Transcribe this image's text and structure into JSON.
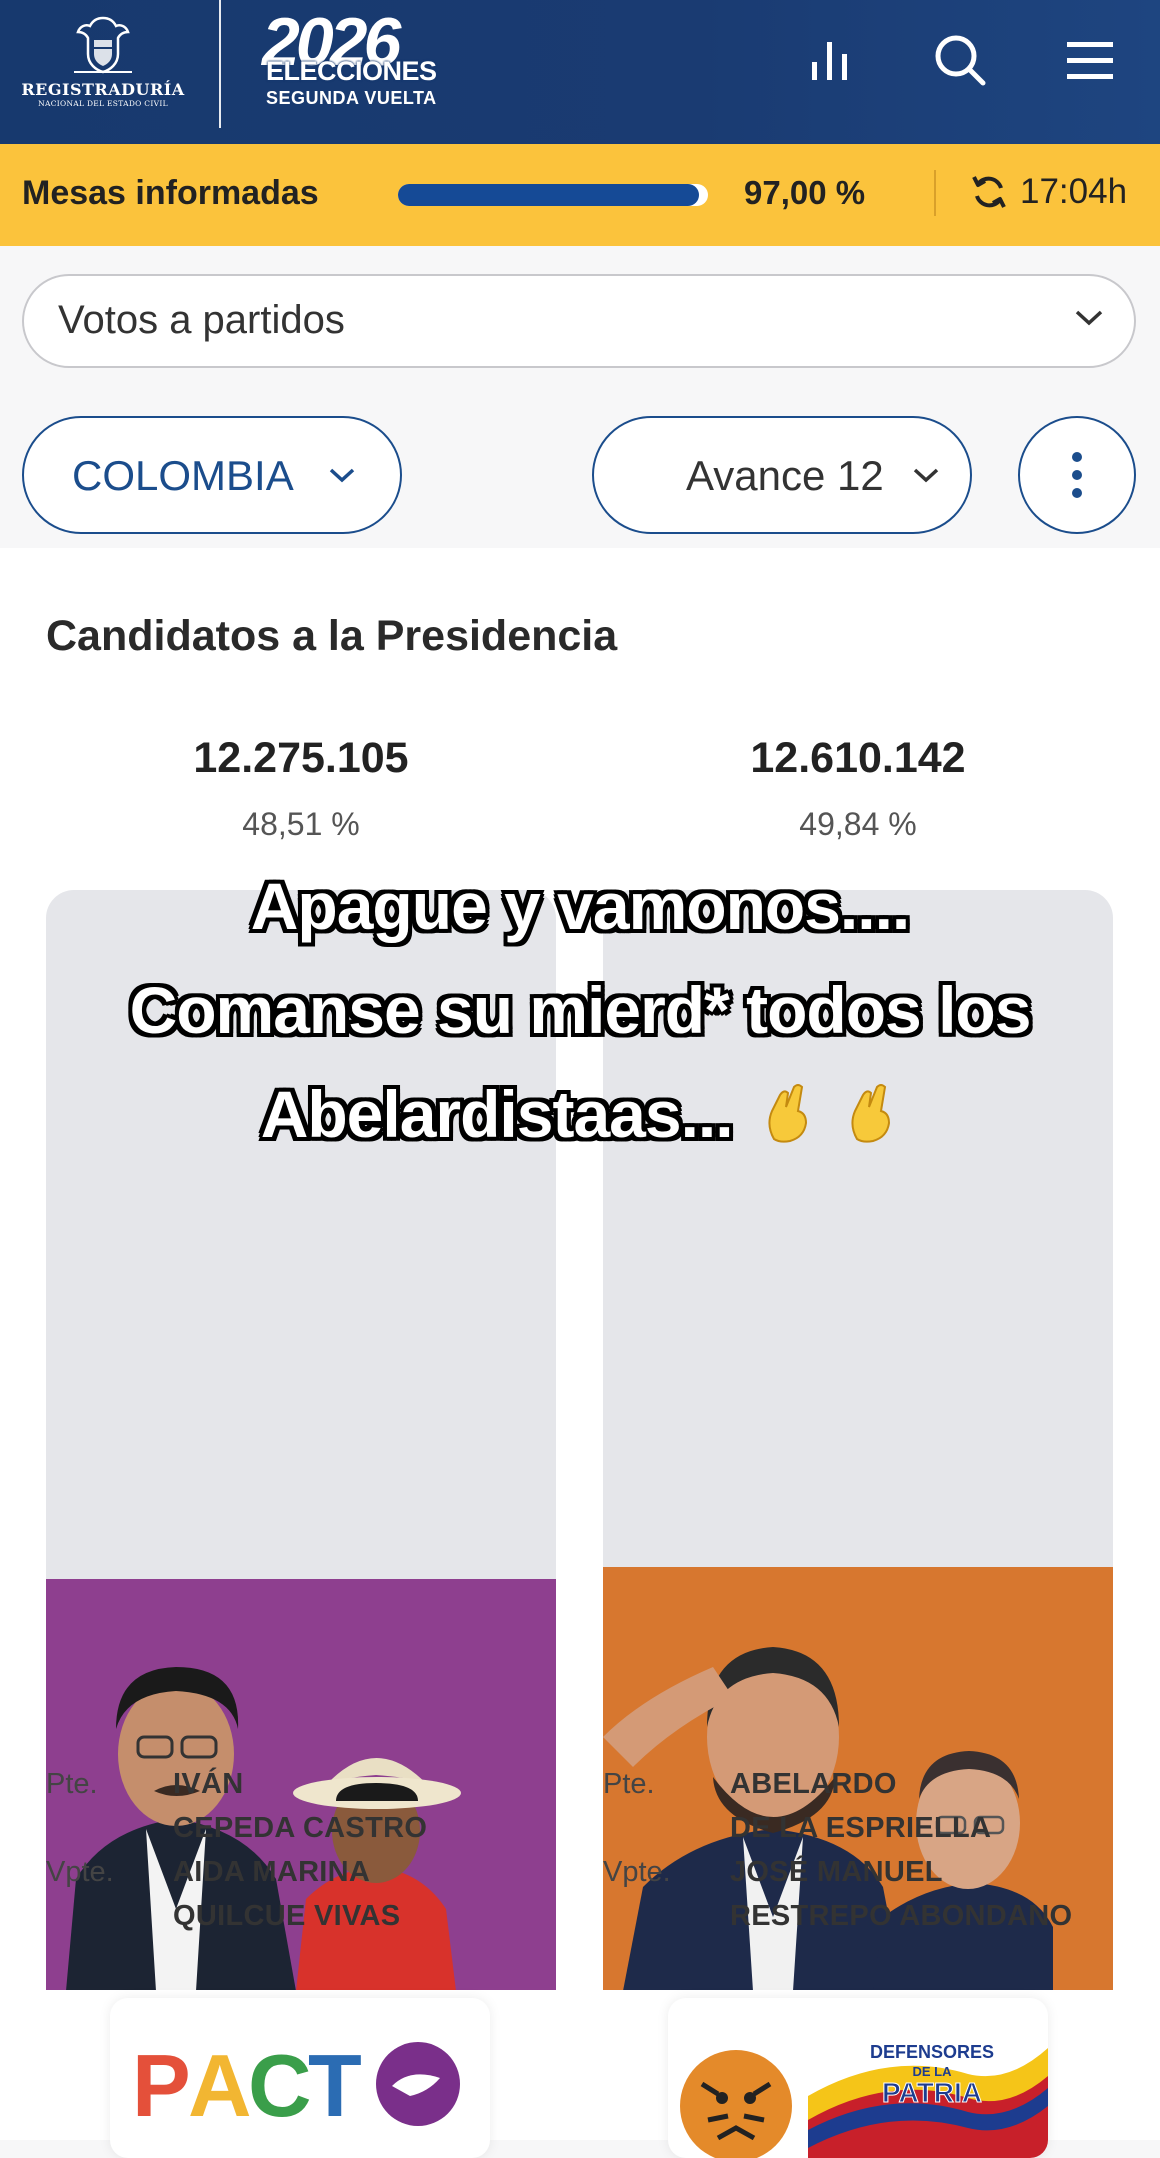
{
  "header": {
    "logo_title": "REGISTRADURÍA",
    "logo_subtitle": "NACIONAL DEL ESTADO CIVIL",
    "election_year": "2026",
    "election_title": "ELECCIONES",
    "election_round": "SEGUNDA VUELTA",
    "icons": [
      "chart-bars-icon",
      "search-icon",
      "menu-icon"
    ]
  },
  "progress": {
    "label": "Mesas informadas",
    "percent_text": "97,00 %",
    "percent_value": 97.0,
    "time": "17:04h",
    "accent_color": "#fbc33c",
    "bar_color": "#154a96"
  },
  "filters": {
    "view_select": "Votos a partidos",
    "region_select": "COLOMBIA",
    "avance_select": "Avance 12"
  },
  "results": {
    "title": "Candidatos a la Presidencia",
    "candidates": [
      {
        "votes": "12.275.105",
        "percent": "48,51 %",
        "percent_value": 48.51,
        "color": "#8e3f8f",
        "pres_role": "Pte.",
        "pres_name_1": "IVÁN",
        "pres_name_2": "CEPEDA CASTRO",
        "vice_role": "Vpte.",
        "vice_name_1": "AIDA MARINA",
        "vice_name_2": "QUILCUE VIVAS",
        "party": "PACTO HISTÓRICO"
      },
      {
        "votes": "12.610.142",
        "percent": "49,84 %",
        "percent_value": 49.84,
        "color": "#d7772f",
        "pres_role": "Pte.",
        "pres_name_1": "ABELARDO",
        "pres_name_2": "DE LA ESPRIELLA",
        "vice_role": "Vpte.",
        "vice_name_1": "JOSÉ MANUEL",
        "vice_name_2": "RESTREPO ABONDANO",
        "party_line_1": "DEFENSORES",
        "party_line_2": "DE LA",
        "party_line_3": "PATRIA"
      }
    ]
  },
  "overlay_caption": {
    "line_1": "Apague y vamonos....",
    "line_2": "Comanse su mierd* todos los",
    "line_3": "Abelardistaas...",
    "emoji": "crossed-fingers-emoji"
  }
}
